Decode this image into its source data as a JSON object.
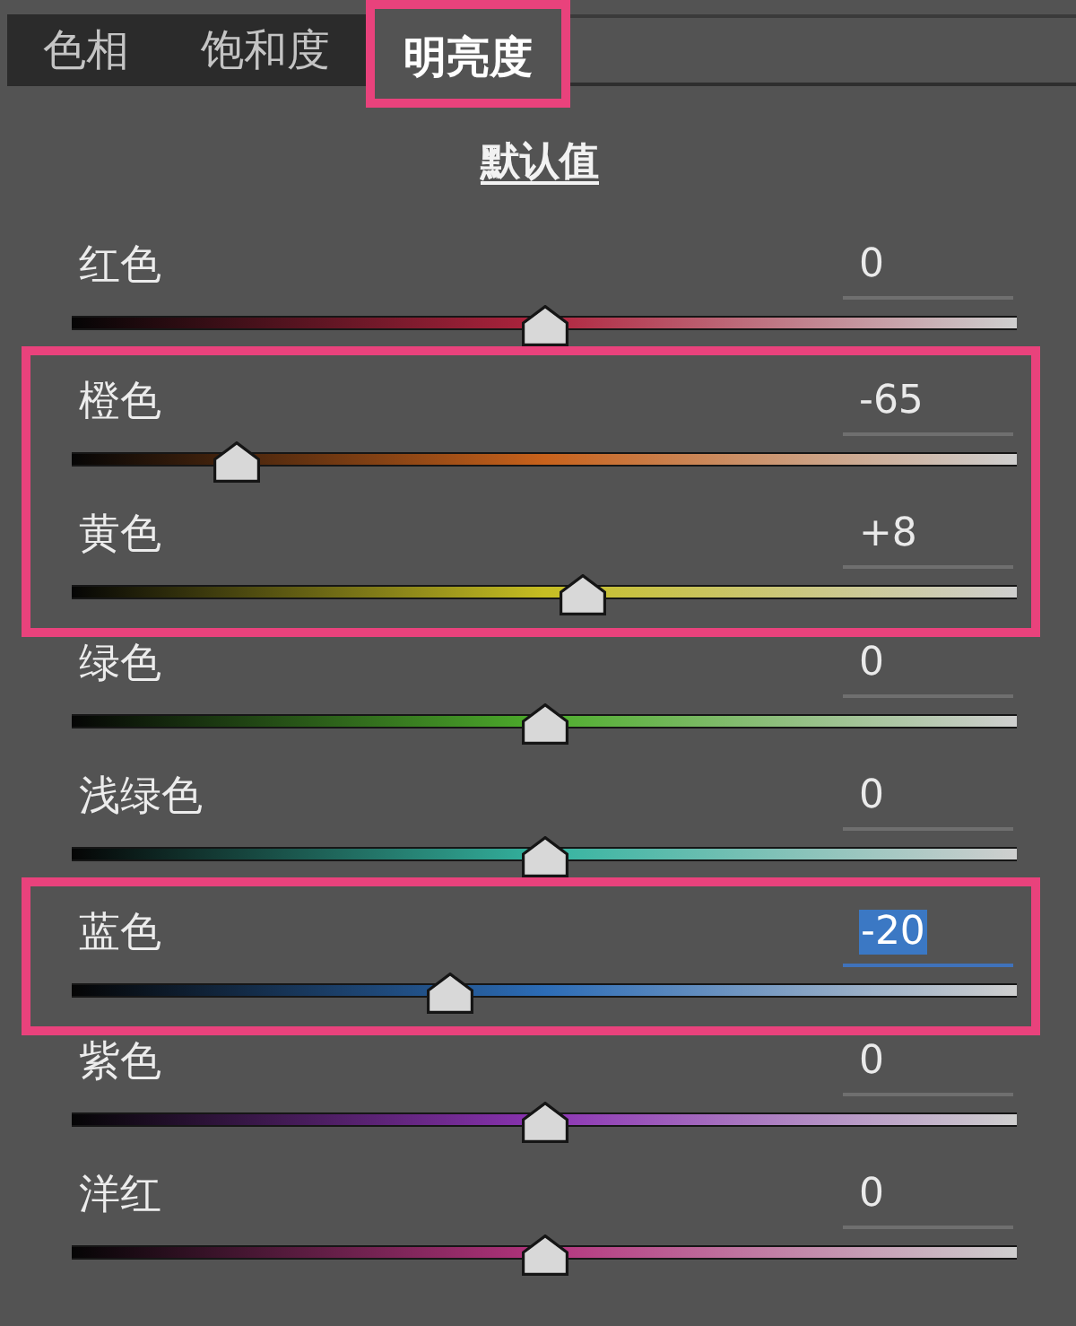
{
  "tabs": [
    {
      "label": "色相",
      "selected": false,
      "highlighted": false
    },
    {
      "label": "饱和度",
      "selected": false,
      "highlighted": false
    },
    {
      "label": "明亮度",
      "selected": true,
      "highlighted": true
    }
  ],
  "reset_link": "默认值",
  "sliders": [
    {
      "label": "红色",
      "value": "0",
      "level": 0.5,
      "color": "#b0243e",
      "focused": false,
      "highlighted": false
    },
    {
      "label": "橙色",
      "value": "-65",
      "level": 0.175,
      "color": "#c8621c",
      "focused": false,
      "highlighted": true
    },
    {
      "label": "黄色",
      "value": "+8",
      "level": 0.54,
      "color": "#c6be22",
      "focused": false,
      "highlighted": true
    },
    {
      "label": "绿色",
      "value": "0",
      "level": 0.5,
      "color": "#4eae2c",
      "focused": false,
      "highlighted": false
    },
    {
      "label": "浅绿色",
      "value": "0",
      "level": 0.5,
      "color": "#34b4a0",
      "focused": false,
      "highlighted": false
    },
    {
      "label": "蓝色",
      "value": "-20",
      "level": 0.4,
      "color": "#2c6cb6",
      "focused": true,
      "highlighted": true
    },
    {
      "label": "紫色",
      "value": "0",
      "level": 0.5,
      "color": "#8c34b4",
      "focused": false,
      "highlighted": false
    },
    {
      "label": "洋红",
      "value": "0",
      "level": 0.5,
      "color": "#b4347e",
      "focused": false,
      "highlighted": false
    }
  ]
}
